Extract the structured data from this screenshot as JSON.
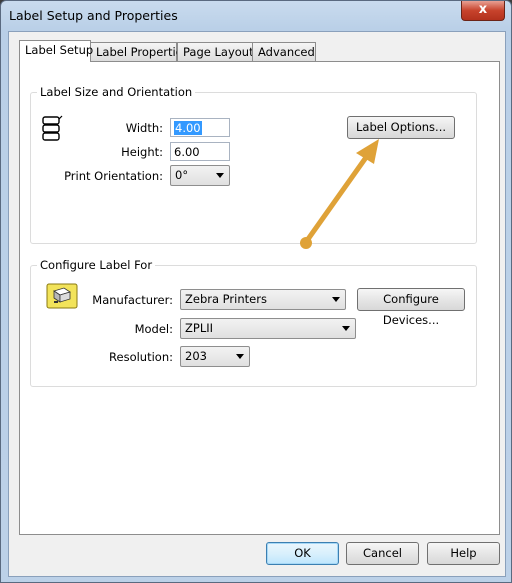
{
  "window": {
    "title": "Label Setup and Properties",
    "close_glyph": "x"
  },
  "tabs": [
    {
      "label": "Label Setup",
      "active": true
    },
    {
      "label": "Label Properties",
      "active": false
    },
    {
      "label": "Page Layout",
      "active": false
    },
    {
      "label": "Advanced",
      "active": false
    }
  ],
  "size_group": {
    "title": "Label Size and Orientation",
    "width_label": "Width:",
    "width_value": "4.00",
    "height_label": "Height:",
    "height_value": "6.00",
    "orientation_label": "Print Orientation:",
    "orientation_value": "0°",
    "label_options_button": "Label Options..."
  },
  "configure_group": {
    "title": "Configure Label For",
    "manufacturer_label": "Manufacturer:",
    "manufacturer_value": "Zebra Printers",
    "configure_devices_button": "Configure Devices...",
    "model_label": "Model:",
    "model_value": "ZPLII",
    "resolution_label": "Resolution:",
    "resolution_value": "203"
  },
  "buttons": {
    "ok": "OK",
    "cancel": "Cancel",
    "help": "Help"
  },
  "colors": {
    "annotation_arrow": "#dfa238",
    "selection": "#3399ff",
    "close_button": "#c7432c"
  }
}
